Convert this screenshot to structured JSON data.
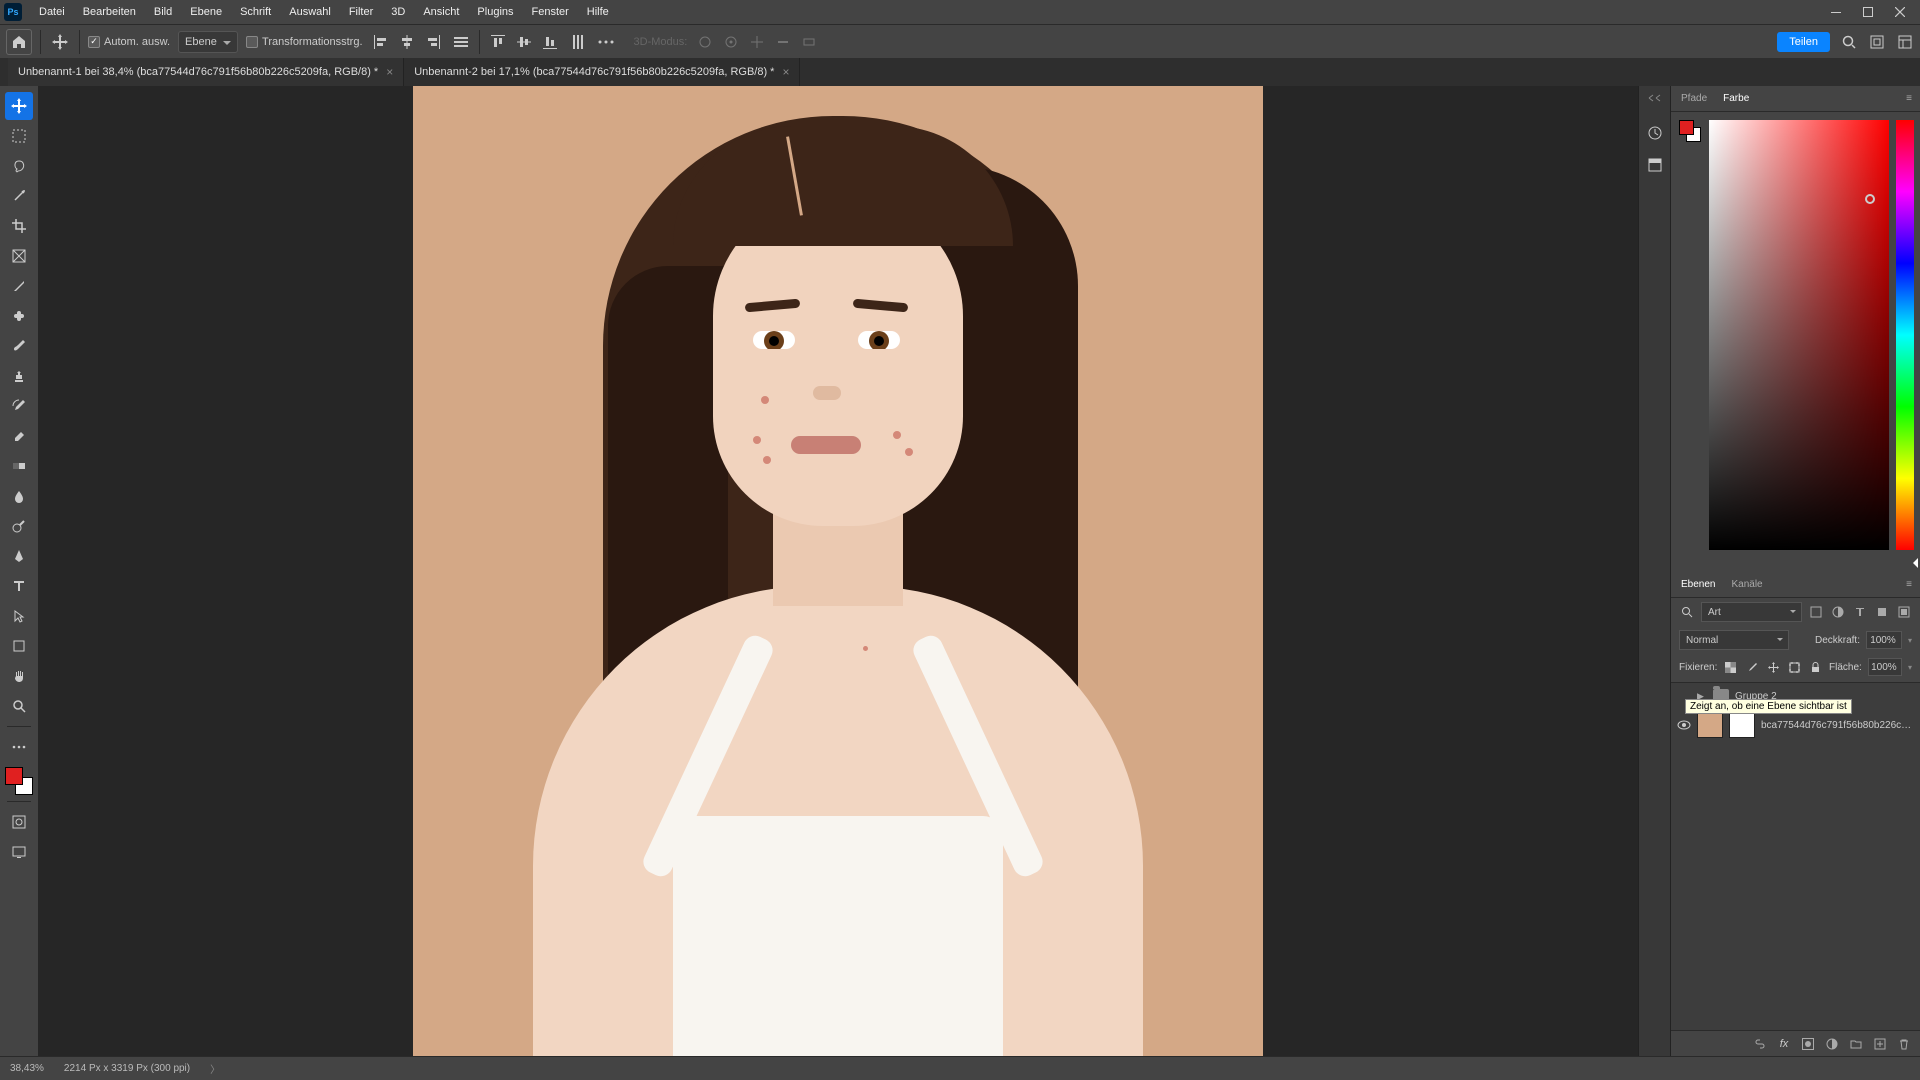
{
  "app": {
    "logo_text": "Ps"
  },
  "menu": {
    "items": [
      "Datei",
      "Bearbeiten",
      "Bild",
      "Ebene",
      "Schrift",
      "Auswahl",
      "Filter",
      "3D",
      "Ansicht",
      "Plugins",
      "Fenster",
      "Hilfe"
    ]
  },
  "options": {
    "auto_select": "Autom. ausw.",
    "target": "Ebene",
    "transform": "Transformationsstrg.",
    "disabled_3d": "3D-Modus:",
    "share": "Teilen"
  },
  "tabs": [
    {
      "label": "Unbenannt-1 bei 38,4% (bca77544d76c791f56b80b226c5209fa, RGB/8) *"
    },
    {
      "label": "Unbenannt-2 bei 17,1% (bca77544d76c791f56b80b226c5209fa, RGB/8) *"
    }
  ],
  "right_tabs_color": {
    "paths": "Pfade",
    "color": "Farbe"
  },
  "layers_panel": {
    "tab_layers": "Ebenen",
    "tab_channels": "Kanäle",
    "filter_label": "Art",
    "blend_mode": "Normal",
    "opacity_label": "Deckkraft:",
    "opacity_value": "100%",
    "lock_label": "Fixieren:",
    "fill_label": "Fläche:",
    "fill_value": "100%",
    "group_name": "Gruppe 2",
    "layer_name": "bca77544d76c791f56b80b226c5209fa",
    "tooltip": "Zeigt an, ob eine Ebene sichtbar ist"
  },
  "status": {
    "zoom": "38,43%",
    "dims": "2214 Px x 3319 Px (300 ppi)"
  }
}
